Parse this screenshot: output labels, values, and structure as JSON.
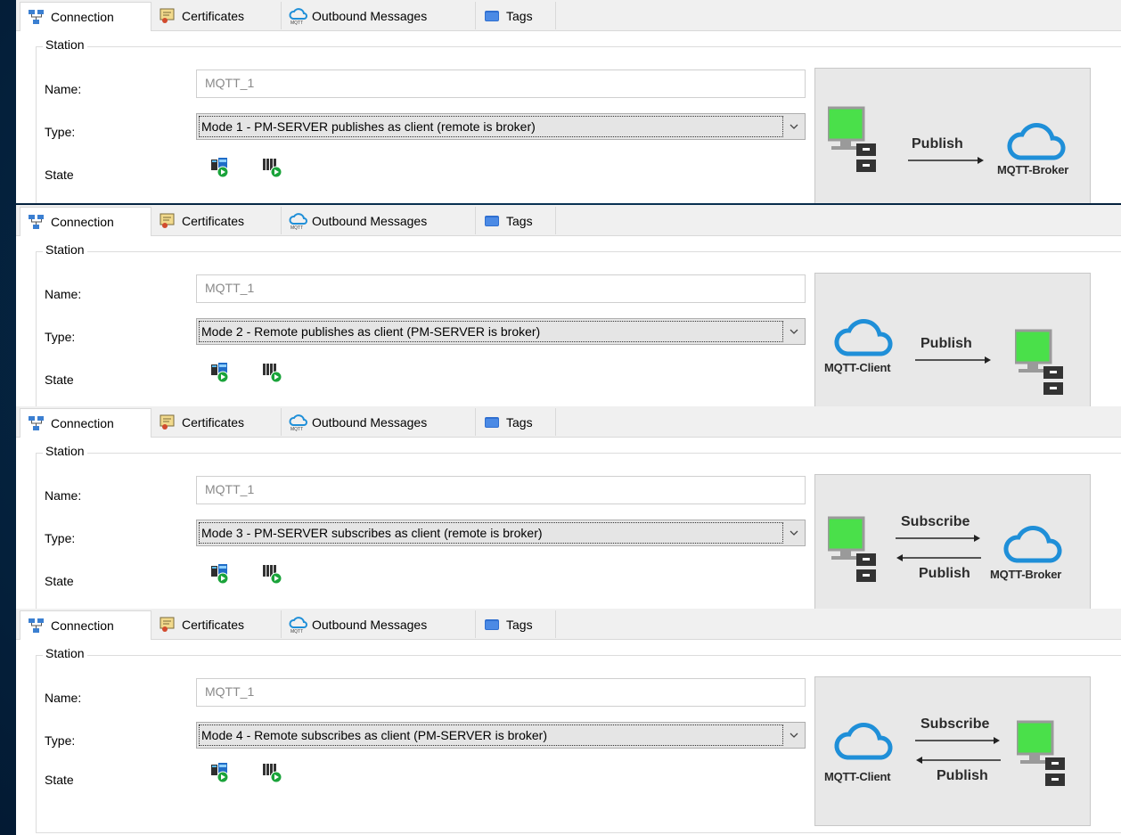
{
  "tabs": [
    {
      "label": "Connection",
      "icon": "network-icon"
    },
    {
      "label": "Certificates",
      "icon": "certificate-icon"
    },
    {
      "label": "Outbound Messages",
      "icon": "mqtt-cloud-icon"
    },
    {
      "label": "Tags",
      "icon": "folder-icon"
    }
  ],
  "form": {
    "group_label": "Station",
    "name_label": "Name:",
    "type_label": "Type:",
    "state_label": "State",
    "name_value": "MQTT_1"
  },
  "panels": [
    {
      "type_value": "Mode 1 - PM-SERVER publishes as client (remote is broker)",
      "diagram": {
        "arrow_top": "Publish",
        "node_label": "MQTT-Broker"
      }
    },
    {
      "type_value": "Mode 2 - Remote publishes as client (PM-SERVER is broker)",
      "diagram": {
        "arrow_top": "Publish",
        "node_label": "MQTT-Client"
      }
    },
    {
      "type_value": "Mode 3 - PM-SERVER subscribes as client (remote is broker)",
      "diagram": {
        "arrow_top": "Subscribe",
        "arrow_bottom": "Publish",
        "node_label": "MQTT-Broker"
      }
    },
    {
      "type_value": "Mode 4 - Remote subscribes as client (PM-SERVER is broker)",
      "diagram": {
        "arrow_top": "Subscribe",
        "arrow_bottom": "Publish",
        "node_label": "MQTT-Client"
      }
    }
  ],
  "colors": {
    "screen_green": "#4ae04a",
    "cloud_blue": "#1f8fd8",
    "play_green": "#1aa33a"
  }
}
